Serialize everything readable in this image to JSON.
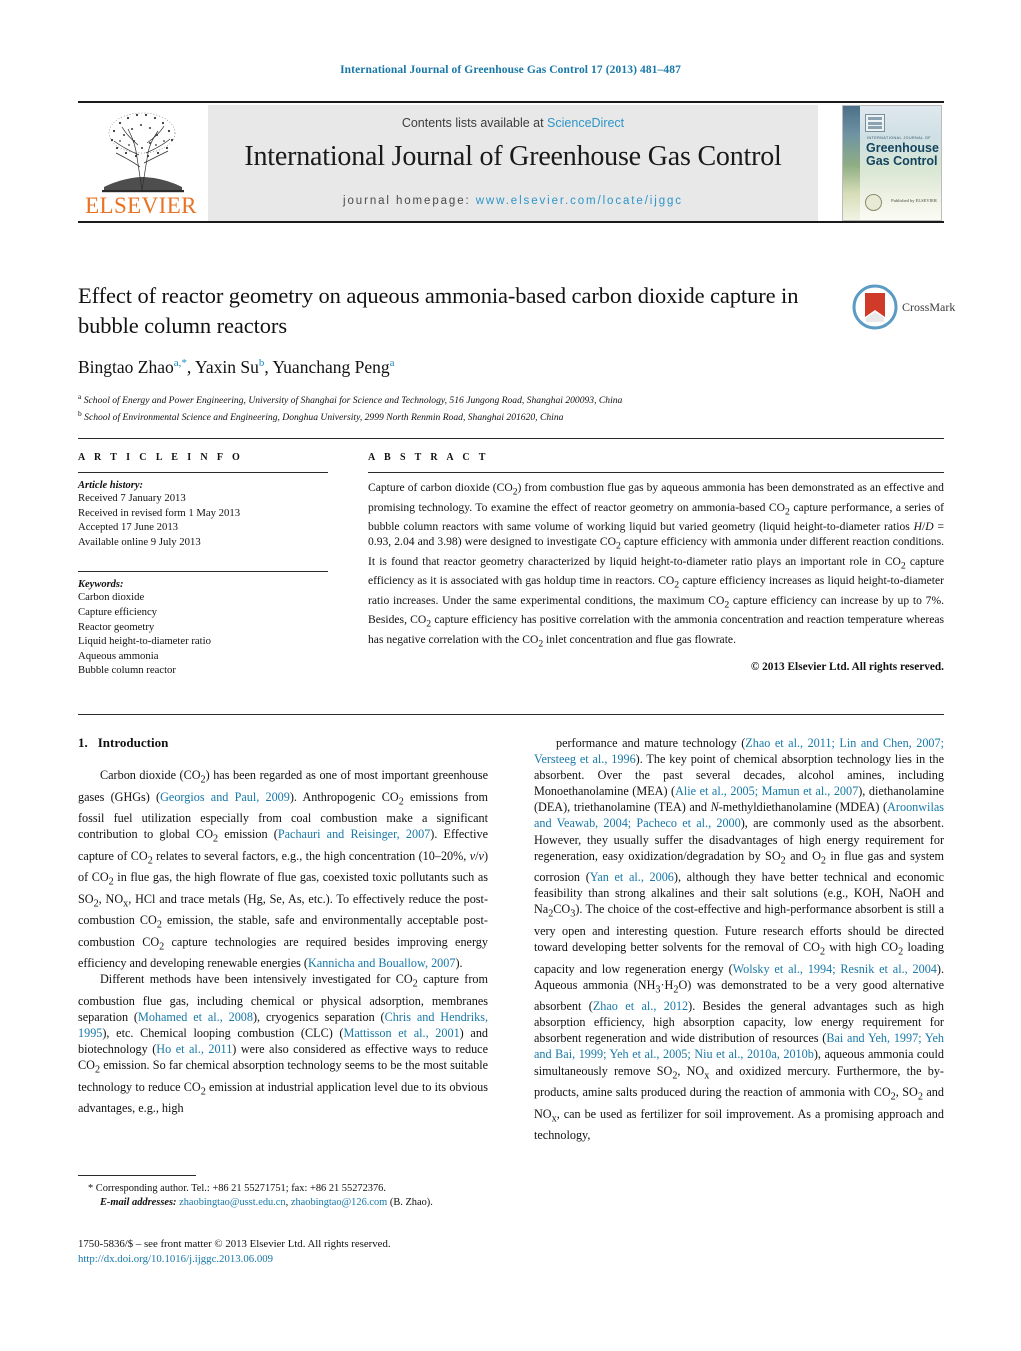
{
  "running_head": "International Journal of Greenhouse Gas Control 17 (2013) 481–487",
  "masthead": {
    "contents_prefix": "Contents lists available at ",
    "sciencedirect": "ScienceDirect",
    "journal_title": "International Journal of Greenhouse Gas Control",
    "homepage_prefix": "journal homepage:",
    "homepage_url": "www.elsevier.com/locate/ijggc",
    "publisher": "ELSEVIER",
    "publisher_color": "#e87325",
    "link_color": "#2e95c9",
    "cover": {
      "supertitle": "INTERNATIONAL JOURNAL OF",
      "line1": "Greenhouse",
      "line2": "Gas Control",
      "publisher_note": "Published by ELSEVIER"
    }
  },
  "article": {
    "title": "Effect of reactor geometry on aqueous ammonia-based carbon dioxide capture in bubble column reactors",
    "crossmark_label": "CrossMark",
    "authors_html": "Bingtao Zhao<sup>a,*</sup>, Yaxin Su<sup>b</sup>, Yuanchang Peng<sup>a</sup>",
    "affiliation_a": "School of Energy and Power Engineering, University of Shanghai for Science and Technology, 516 Jungong Road, Shanghai 200093, China",
    "affiliation_b": "School of Environmental Science and Engineering, Donghua University, 2999 North Renmin Road, Shanghai 201620, China"
  },
  "article_info": {
    "heading": "A R T I C L E    I N F O",
    "history_label": "Article history:",
    "history": [
      "Received 7 January 2013",
      "Received in revised form 1 May 2013",
      "Accepted 17 June 2013",
      "Available online 9 July 2013"
    ],
    "keywords_label": "Keywords:",
    "keywords": [
      "Carbon dioxide",
      "Capture efficiency",
      "Reactor geometry",
      "Liquid height-to-diameter ratio",
      "Aqueous ammonia",
      "Bubble column reactor"
    ]
  },
  "abstract": {
    "heading": "A B S T R A C T",
    "text_html": "Capture of carbon dioxide (CO<sub>2</sub>) from combustion flue gas by aqueous ammonia has been demonstrated as an effective and promising technology. To examine the effect of reactor geometry on ammonia-based CO<sub>2</sub> capture performance, a series of bubble column reactors with same volume of working liquid but varied geometry (liquid height-to-diameter ratios <em>H</em>/<em>D</em> = 0.93, 2.04 and 3.98) were designed to investigate CO<sub>2</sub> capture efficiency with ammonia under different reaction conditions. It is found that reactor geometry characterized by liquid height-to-diameter ratio plays an important role in CO<sub>2</sub> capture efficiency as it is associated with gas holdup time in reactors. CO<sub>2</sub> capture efficiency increases as liquid height-to-diameter ratio increases. Under the same experimental conditions, the maximum CO<sub>2</sub> capture efficiency can increase by up to 7%. Besides, CO<sub>2</sub> capture efficiency has positive correlation with the ammonia concentration and reaction temperature whereas has negative correlation with the CO<sub>2</sub> inlet concentration and flue gas flowrate.",
    "copyright": "© 2013 Elsevier Ltd. All rights reserved."
  },
  "body": {
    "section_number": "1.",
    "section_title": "Introduction",
    "left_paragraphs_html": [
      "Carbon dioxide (CO<sub>2</sub>) has been regarded as one of most important greenhouse gases (GHGs) (<span class=\"ref\">Georgios and Paul, 2009</span>). Anthropogenic CO<sub>2</sub> emissions from fossil fuel utilization especially from coal combustion make a significant contribution to global CO<sub>2</sub> emission (<span class=\"ref\">Pachauri and Reisinger, 2007</span>). Effective capture of CO<sub>2</sub> relates to several factors, e.g., the high concentration (10–20%, <em>v</em>/<em>v</em>) of CO<sub>2</sub> in flue gas, the high flowrate of flue gas, coexisted toxic pollutants such as SO<sub>2</sub>, NO<sub>x</sub>, HCl and trace metals (Hg, Se, As, etc.). To effectively reduce the post-combustion CO<sub>2</sub> emission, the stable, safe and environmentally acceptable post-combustion CO<sub>2</sub> capture technologies are required besides improving energy efficiency and developing renewable energies (<span class=\"ref\">Kannicha and Bouallow, 2007</span>).",
      "Different methods have been intensively investigated for CO<sub>2</sub> capture from combustion flue gas, including chemical or physical adsorption, membranes separation (<span class=\"ref\">Mohamed et al., 2008</span>), cryogenics separation (<span class=\"ref\">Chris and Hendriks, 1995</span>), etc. Chemical looping combustion (CLC) (<span class=\"ref\">Mattisson et al., 2001</span>) and biotechnology (<span class=\"ref\">Ho et al., 2011</span>) were also considered as effective ways to reduce CO<sub>2</sub> emission. So far chemical absorption technology seems to be the most suitable technology to reduce CO<sub>2</sub> emission at industrial application level due to its obvious advantages, e.g., high"
    ],
    "right_paragraphs_html": [
      "performance and mature technology (<span class=\"ref\">Zhao et al., 2011; Lin and Chen, 2007; Versteeg et al., 1996</span>). The key point of chemical absorption technology lies in the absorbent. Over the past several decades, alcohol amines, including Monoethanolamine (MEA) (<span class=\"ref\">Alie et al., 2005; Mamun et al., 2007</span>), diethanolamine (DEA), triethanolamine (TEA) and <em>N</em>-methyldiethanolamine (MDEA) (<span class=\"ref\">Aroonwilas and Veawab, 2004; Pacheco et al., 2000</span>), are commonly used as the absorbent. However, they usually suffer the disadvantages of high energy requirement for regeneration, easy oxidization/degradation by SO<sub>2</sub> and O<sub>2</sub> in flue gas and system corrosion (<span class=\"ref\">Yan et al., 2006</span>), although they have better technical and economic feasibility than strong alkalines and their salt solutions (e.g., KOH, NaOH and Na<sub>2</sub>CO<sub>3</sub>). The choice of the cost-effective and high-performance absorbent is still a very open and interesting question. Future research efforts should be directed toward developing better solvents for the removal of CO<sub>2</sub> with high CO<sub>2</sub> loading capacity and low regeneration energy (<span class=\"ref\">Wolsky et al., 1994; Resnik et al., 2004</span>). Aqueous ammonia (NH<sub>3</sub>·H<sub>2</sub>O) was demonstrated to be a very good alternative absorbent (<span class=\"ref\">Zhao et al., 2012</span>). Besides the general advantages such as high absorption efficiency, high absorption capacity, low energy requirement for absorbent regeneration and wide distribution of resources (<span class=\"ref\">Bai and Yeh, 1997; Yeh and Bai, 1999; Yeh et al., 2005; Niu et al., 2010a, 2010b</span>), aqueous ammonia could simultaneously remove SO<sub>2</sub>, NO<sub>x</sub> and oxidized mercury. Furthermore, the by-products, amine salts produced during the reaction of ammonia with CO<sub>2</sub>, SO<sub>2</sub> and NO<sub>x</sub>, can be used as fertilizer for soil improvement. As a promising approach and technology,"
    ]
  },
  "footnote": {
    "corresponding_html": "* Corresponding author. Tel.: +86 21 55271751; fax: +86 21 55272376.",
    "email_label": "E-mail addresses:",
    "email1": "zhaobingtao@usst.edu.cn",
    "email2": "zhaobingtao@126.com",
    "email_suffix": "(B. Zhao)."
  },
  "frontmatter": {
    "line1": "1750-5836/$ – see front matter © 2013 Elsevier Ltd. All rights reserved.",
    "doi": "http://dx.doi.org/10.1016/j.ijggc.2013.06.009"
  }
}
